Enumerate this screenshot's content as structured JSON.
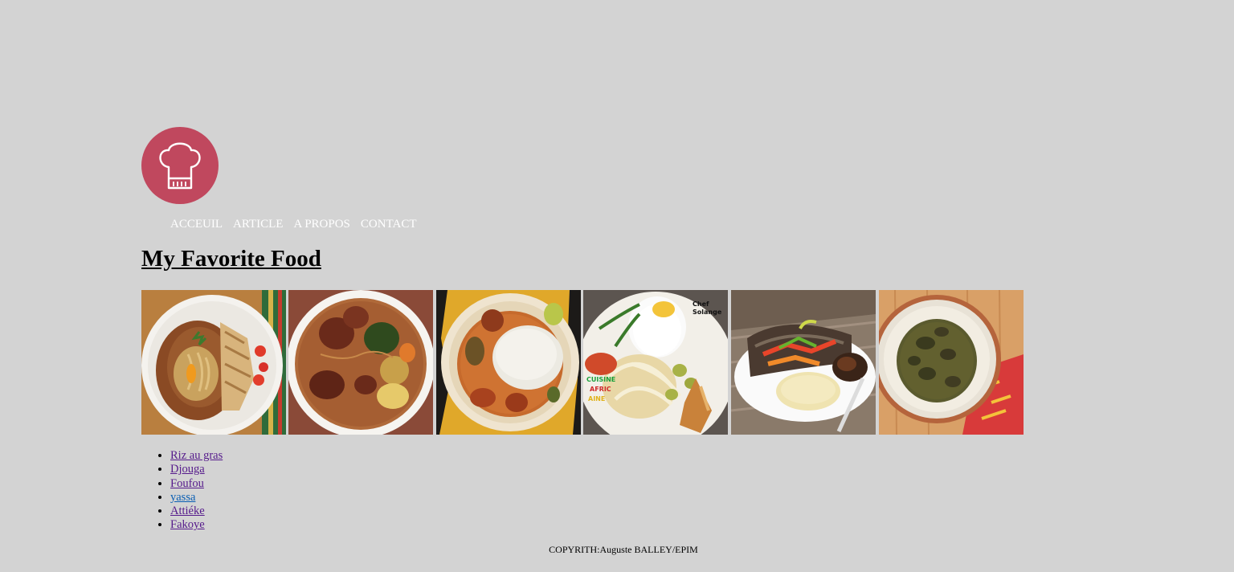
{
  "header": {
    "logo_icon": "chef-hat-icon",
    "logo_color": "#c0485e"
  },
  "nav": {
    "items": [
      {
        "label": "ACCEUIL"
      },
      {
        "label": "ARTICLE"
      },
      {
        "label": "A PROPOS"
      },
      {
        "label": "CONTACT"
      }
    ]
  },
  "main": {
    "title": "My Favorite Food",
    "gallery": [
      {
        "dish": "riz-au-gras"
      },
      {
        "dish": "djouga"
      },
      {
        "dish": "foufou"
      },
      {
        "dish": "yassa",
        "watermark": [
          "Chef",
          "Solange",
          "CUISINE",
          "AFRIC",
          "AINE"
        ]
      },
      {
        "dish": "attieke"
      },
      {
        "dish": "fakoye"
      }
    ],
    "food_links": [
      {
        "label": "Riz au gras"
      },
      {
        "label": "Djouga"
      },
      {
        "label": "Foufou"
      },
      {
        "label": "yassa"
      },
      {
        "label": "Attiéke"
      },
      {
        "label": "Fakoye"
      }
    ]
  },
  "footer": {
    "copyright": "COPYRITH:Auguste BALLEY/EPIM"
  },
  "colors": {
    "background": "#d3d3d3",
    "nav_text": "#ffffff",
    "visited_link": "#551a8b",
    "link": "#0a5fb4"
  }
}
